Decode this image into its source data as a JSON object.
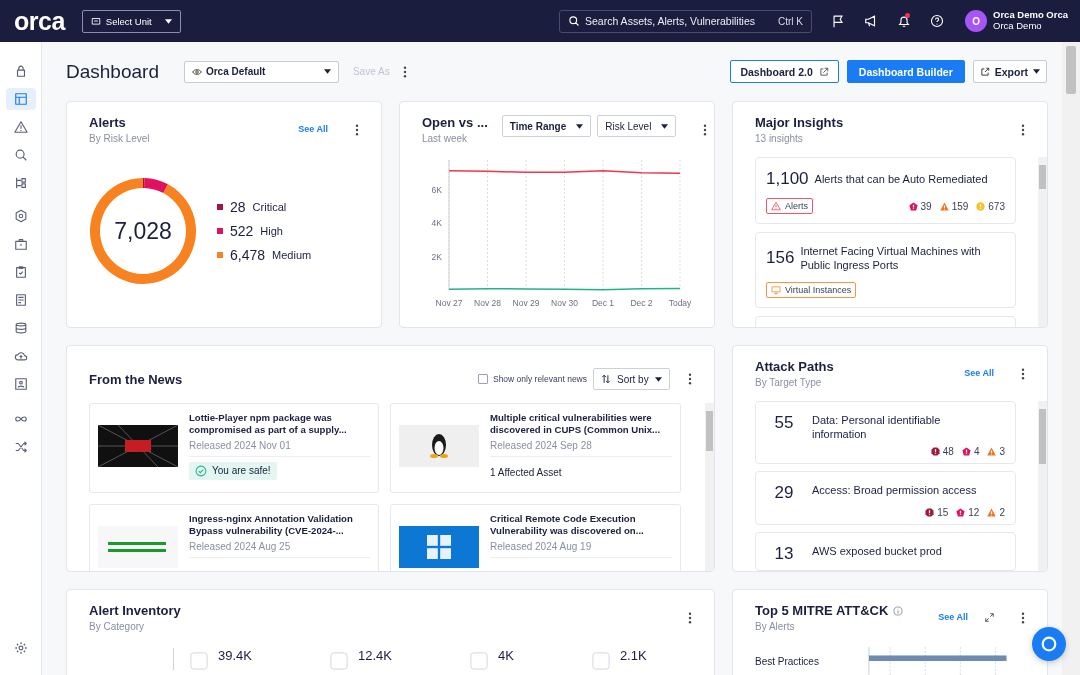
{
  "topbar": {
    "logo": "orca",
    "unit_select": "Select Unit",
    "search": {
      "placeholder": "Search Assets, Alerts, Vulnerabilities",
      "shortcut": "Ctrl K"
    },
    "notification": true,
    "user": {
      "avatar": "O",
      "name": "Orca Demo Orca",
      "org": "Orca Demo"
    }
  },
  "sidebar": {
    "items": [
      {
        "selected": false
      },
      {
        "selected": true
      },
      {
        "selected": false
      },
      {
        "selected": false
      },
      {
        "selected": false
      },
      {
        "selected": false
      },
      {
        "selected": false
      },
      {
        "selected": false
      },
      {
        "selected": false
      },
      {
        "selected": false
      },
      {
        "selected": false
      },
      {
        "selected": false
      },
      {
        "selected": false
      },
      {
        "selected": false
      }
    ]
  },
  "header": {
    "title": "Dashboard",
    "view_select": "Orca Default",
    "save_as": {
      "label": "Save As",
      "disabled": true
    },
    "buttons": [
      {
        "label": "Dashboard 2.0",
        "kind": "outline"
      },
      {
        "label": "Dashboard Builder",
        "kind": "primary"
      },
      {
        "label": "Export",
        "kind": "menu"
      }
    ]
  },
  "alerts_card": {
    "title": "Alerts",
    "subtitle": "By Risk Level",
    "see_all": "See All",
    "total": "7,028",
    "legend": [
      {
        "value": "28",
        "color": "#a3173f"
      },
      {
        "value": "522",
        "color": "#e0115f"
      },
      {
        "value": "6,478",
        "color": "#f7821f"
      }
    ],
    "chart_data": {
      "type": "donut",
      "categories": [
        "Critical",
        "High",
        "Medium"
      ],
      "values": [
        0.4,
        7.43,
        92.17
      ]
    }
  },
  "trend_card": {
    "title": "Open vs ...",
    "subtitle": "Last week",
    "filters": [
      {
        "label": "Time Range",
        "bold": true
      },
      {
        "label": "Risk Level",
        "bold": false
      }
    ],
    "chart_data": {
      "type": "line",
      "grid": true,
      "ylim": [
        0,
        7800
      ],
      "categories": [
        "Nov 27",
        "Nov 28",
        "Nov 29",
        "Nov 30",
        "Dec 1",
        "Dec 2",
        "Today"
      ],
      "yticks": [
        {
          "value": 2000,
          "label": "2K"
        },
        {
          "value": 4000,
          "label": "4K"
        },
        {
          "value": 6000,
          "label": "6K"
        }
      ],
      "series": [
        {
          "color": "#f0364a",
          "values": [
            7150,
            7120,
            7060,
            7060,
            7150,
            7030,
            7010
          ]
        },
        {
          "color": "#1fb58b",
          "values": [
            40,
            80,
            60,
            50,
            20,
            80,
            90
          ]
        }
      ]
    }
  },
  "insights_card": {
    "title": "Major Insights",
    "subtitle": "13 insights",
    "items": [
      {
        "count": "1,100",
        "text": "Alerts that can be Auto Remediated",
        "tag": {
          "label": "Alerts",
          "kind": "alerts",
          "color": "#f0566a"
        },
        "severities": [
          {
            "kind": "high",
            "value": "39"
          },
          {
            "kind": "medium",
            "value": "159"
          },
          {
            "kind": "low",
            "value": "673"
          }
        ]
      },
      {
        "count": "156",
        "text": "Internet Facing Virtual Machines with Public Ingress Ports",
        "tag": {
          "label": "Virtual Instances",
          "kind": "instances",
          "color": "#f7943f"
        }
      }
    ]
  },
  "news_card": {
    "title": "From the News",
    "relevant_only": {
      "label": "Show only relevant news",
      "checked": false
    },
    "sort": "Sort by",
    "items": [
      {
        "title": "Lottie-Player npm package was compromised as part of a supply...",
        "released": "Released 2024 Nov 01",
        "status": {
          "kind": "safe",
          "text": "You are safe!"
        }
      },
      {
        "title": "Multiple critical vulnerabilities were discovered in CUPS (Common Unix...",
        "released": "Released 2024 Sep 28",
        "status": {
          "kind": "affected",
          "text": "1 Affected Asset"
        }
      },
      {
        "title": "Ingress-nginx Annotation Validation Bypass vulnerability (CVE-2024-...",
        "released": "Released 2024 Aug 25"
      },
      {
        "title": "Critical Remote Code Execution Vulnerability was discovered on...",
        "released": "Released 2024 Aug 19"
      }
    ]
  },
  "attack_paths_card": {
    "title": "Attack Paths",
    "subtitle": "By Target Type",
    "see_all": "See All",
    "items": [
      {
        "count": "55",
        "text": "Data: Personal identifiable information",
        "severities": [
          {
            "kind": "critical",
            "value": "48"
          },
          {
            "kind": "high",
            "value": "4"
          },
          {
            "kind": "medium",
            "value": "3"
          }
        ]
      },
      {
        "count": "29",
        "text": "Access: Broad permission access",
        "severities": [
          {
            "kind": "critical",
            "value": "15"
          },
          {
            "kind": "high",
            "value": "12"
          },
          {
            "kind": "medium",
            "value": "2"
          }
        ]
      },
      {
        "count": "13",
        "text": "AWS exposed bucket prod"
      }
    ]
  },
  "inventory_card": {
    "title": "Alert Inventory",
    "subtitle": "By Category",
    "values": [
      "39.4K",
      "12.4K",
      "4K",
      "2.1K"
    ]
  },
  "mitre_card": {
    "title": "Top 5 MITRE ATT&CK",
    "subtitle": "By Alerts",
    "see_all": "See All",
    "rows": [
      "Best Practices"
    ]
  }
}
